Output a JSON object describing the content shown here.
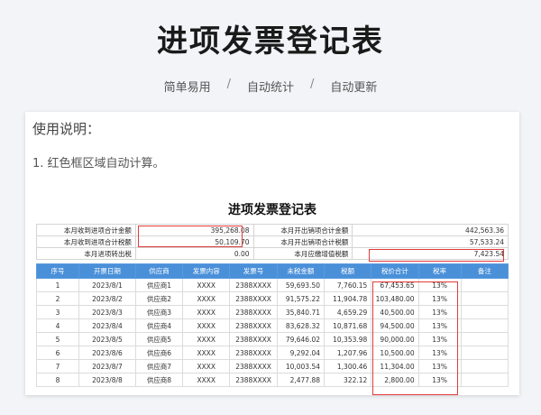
{
  "page": {
    "title": "进项发票登记表",
    "nav": [
      "简单易用",
      "自动统计",
      "自动更新"
    ],
    "nav_sep": "/"
  },
  "usage": {
    "title": "使用说明：",
    "note": "1. 红色框区域自动计算。"
  },
  "sheet": {
    "title": "进项发票登记表",
    "summary": {
      "rows": [
        {
          "l1": "本月收到进项合计金额",
          "v1": "395,268.08",
          "l2": "本月开出销项合计金额",
          "v2": "442,563.36"
        },
        {
          "l1": "本月收到进项合计税额",
          "v1": "50,109.70",
          "l2": "本月开出销项合计税额",
          "v2": "57,533.24"
        },
        {
          "l1": "本月进项转出税",
          "v1": "0.00",
          "l2": "本月应缴增值税额",
          "v2": "7,423.54"
        }
      ]
    },
    "columns": [
      "序号",
      "开票日期",
      "供应商",
      "发票内容",
      "发票号",
      "未税金额",
      "税额",
      "税价合计",
      "税率",
      "备注"
    ],
    "rows": [
      [
        "1",
        "2023/8/1",
        "供应商1",
        "XXXX",
        "2388XXXX",
        "59,693.50",
        "7,760.15",
        "67,453.65",
        "13%",
        ""
      ],
      [
        "2",
        "2023/8/2",
        "供应商2",
        "XXXX",
        "2388XXXX",
        "91,575.22",
        "11,904.78",
        "103,480.00",
        "13%",
        ""
      ],
      [
        "3",
        "2023/8/3",
        "供应商3",
        "XXXX",
        "2388XXXX",
        "35,840.71",
        "4,659.29",
        "40,500.00",
        "13%",
        ""
      ],
      [
        "4",
        "2023/8/4",
        "供应商4",
        "XXXX",
        "2388XXXX",
        "83,628.32",
        "10,871.68",
        "94,500.00",
        "13%",
        ""
      ],
      [
        "5",
        "2023/8/5",
        "供应商5",
        "XXXX",
        "2388XXXX",
        "79,646.02",
        "10,353.98",
        "90,000.00",
        "13%",
        ""
      ],
      [
        "6",
        "2023/8/6",
        "供应商6",
        "XXXX",
        "2388XXXX",
        "9,292.04",
        "1,207.96",
        "10,500.00",
        "13%",
        ""
      ],
      [
        "7",
        "2023/8/7",
        "供应商7",
        "XXXX",
        "2388XXXX",
        "10,003.54",
        "1,300.46",
        "11,304.00",
        "13%",
        ""
      ],
      [
        "8",
        "2023/8/8",
        "供应商8",
        "XXXX",
        "2388XXXX",
        "2,477.88",
        "322.12",
        "2,800.00",
        "13%",
        ""
      ]
    ]
  },
  "colors": {
    "header_blue": "#4a90d9",
    "highlight_red": "#e23b3b"
  }
}
